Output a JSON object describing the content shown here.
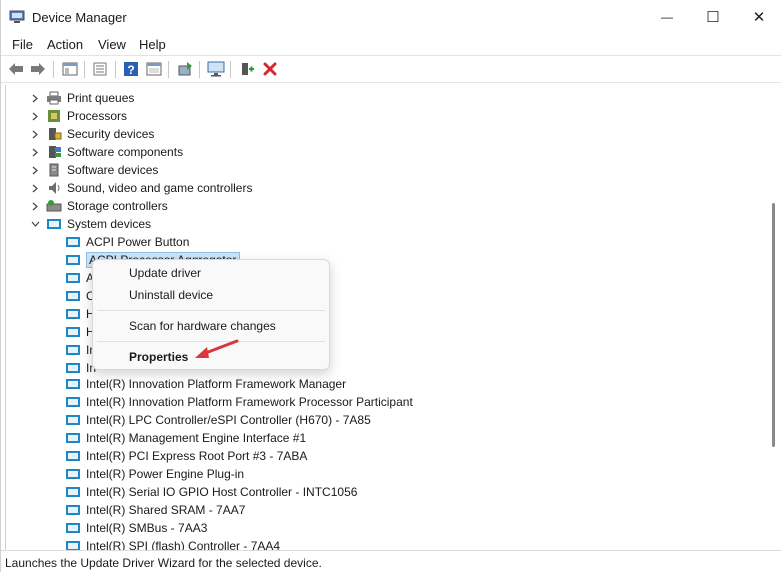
{
  "window": {
    "title": "Device Manager"
  },
  "window_controls": {
    "minimize": "—",
    "maximize": "☐",
    "close": "✕"
  },
  "menu": [
    "File",
    "Action",
    "View",
    "Help"
  ],
  "tree": {
    "categories": [
      {
        "label": "Print queues",
        "icon": "printer-icon",
        "expanded": false
      },
      {
        "label": "Processors",
        "icon": "processor-icon",
        "expanded": false
      },
      {
        "label": "Security devices",
        "icon": "security-icon",
        "expanded": false
      },
      {
        "label": "Software components",
        "icon": "software-component-icon",
        "expanded": false
      },
      {
        "label": "Software devices",
        "icon": "software-device-icon",
        "expanded": false
      },
      {
        "label": "Sound, video and game controllers",
        "icon": "speaker-icon",
        "expanded": false
      },
      {
        "label": "Storage controllers",
        "icon": "storage-icon",
        "expanded": false
      },
      {
        "label": "System devices",
        "icon": "system-folder-icon",
        "expanded": true
      }
    ],
    "children": [
      "ACPI Power Button",
      "ACPI Processor Aggregator",
      "A",
      "C",
      "H",
      "H",
      "In",
      "In",
      "Intel(R) Innovation Platform Framework Manager",
      "Intel(R) Innovation Platform Framework Processor Participant",
      "Intel(R) LPC Controller/eSPI Controller (H670) - 7A85",
      "Intel(R) Management Engine Interface #1",
      "Intel(R) PCI Express Root Port #3 - 7ABA",
      "Intel(R) Power Engine Plug-in",
      "Intel(R) Serial IO GPIO Host Controller - INTC1056",
      "Intel(R) Shared SRAM - 7AA7",
      "Intel(R) SMBus - 7AA3",
      "Intel(R) SPI (flash) Controller - 7AA4"
    ],
    "selected": "ACPI Processor Aggregator"
  },
  "context_menu": {
    "update": "Update driver",
    "uninstall": "Uninstall device",
    "scan": "Scan for hardware changes",
    "properties": "Properties"
  },
  "status": {
    "text": "Launches the Update Driver Wizard for the selected device."
  },
  "colors": {
    "selection": "#cce4f7",
    "arrow": "#d9363e",
    "folder": "#1e88c7"
  }
}
